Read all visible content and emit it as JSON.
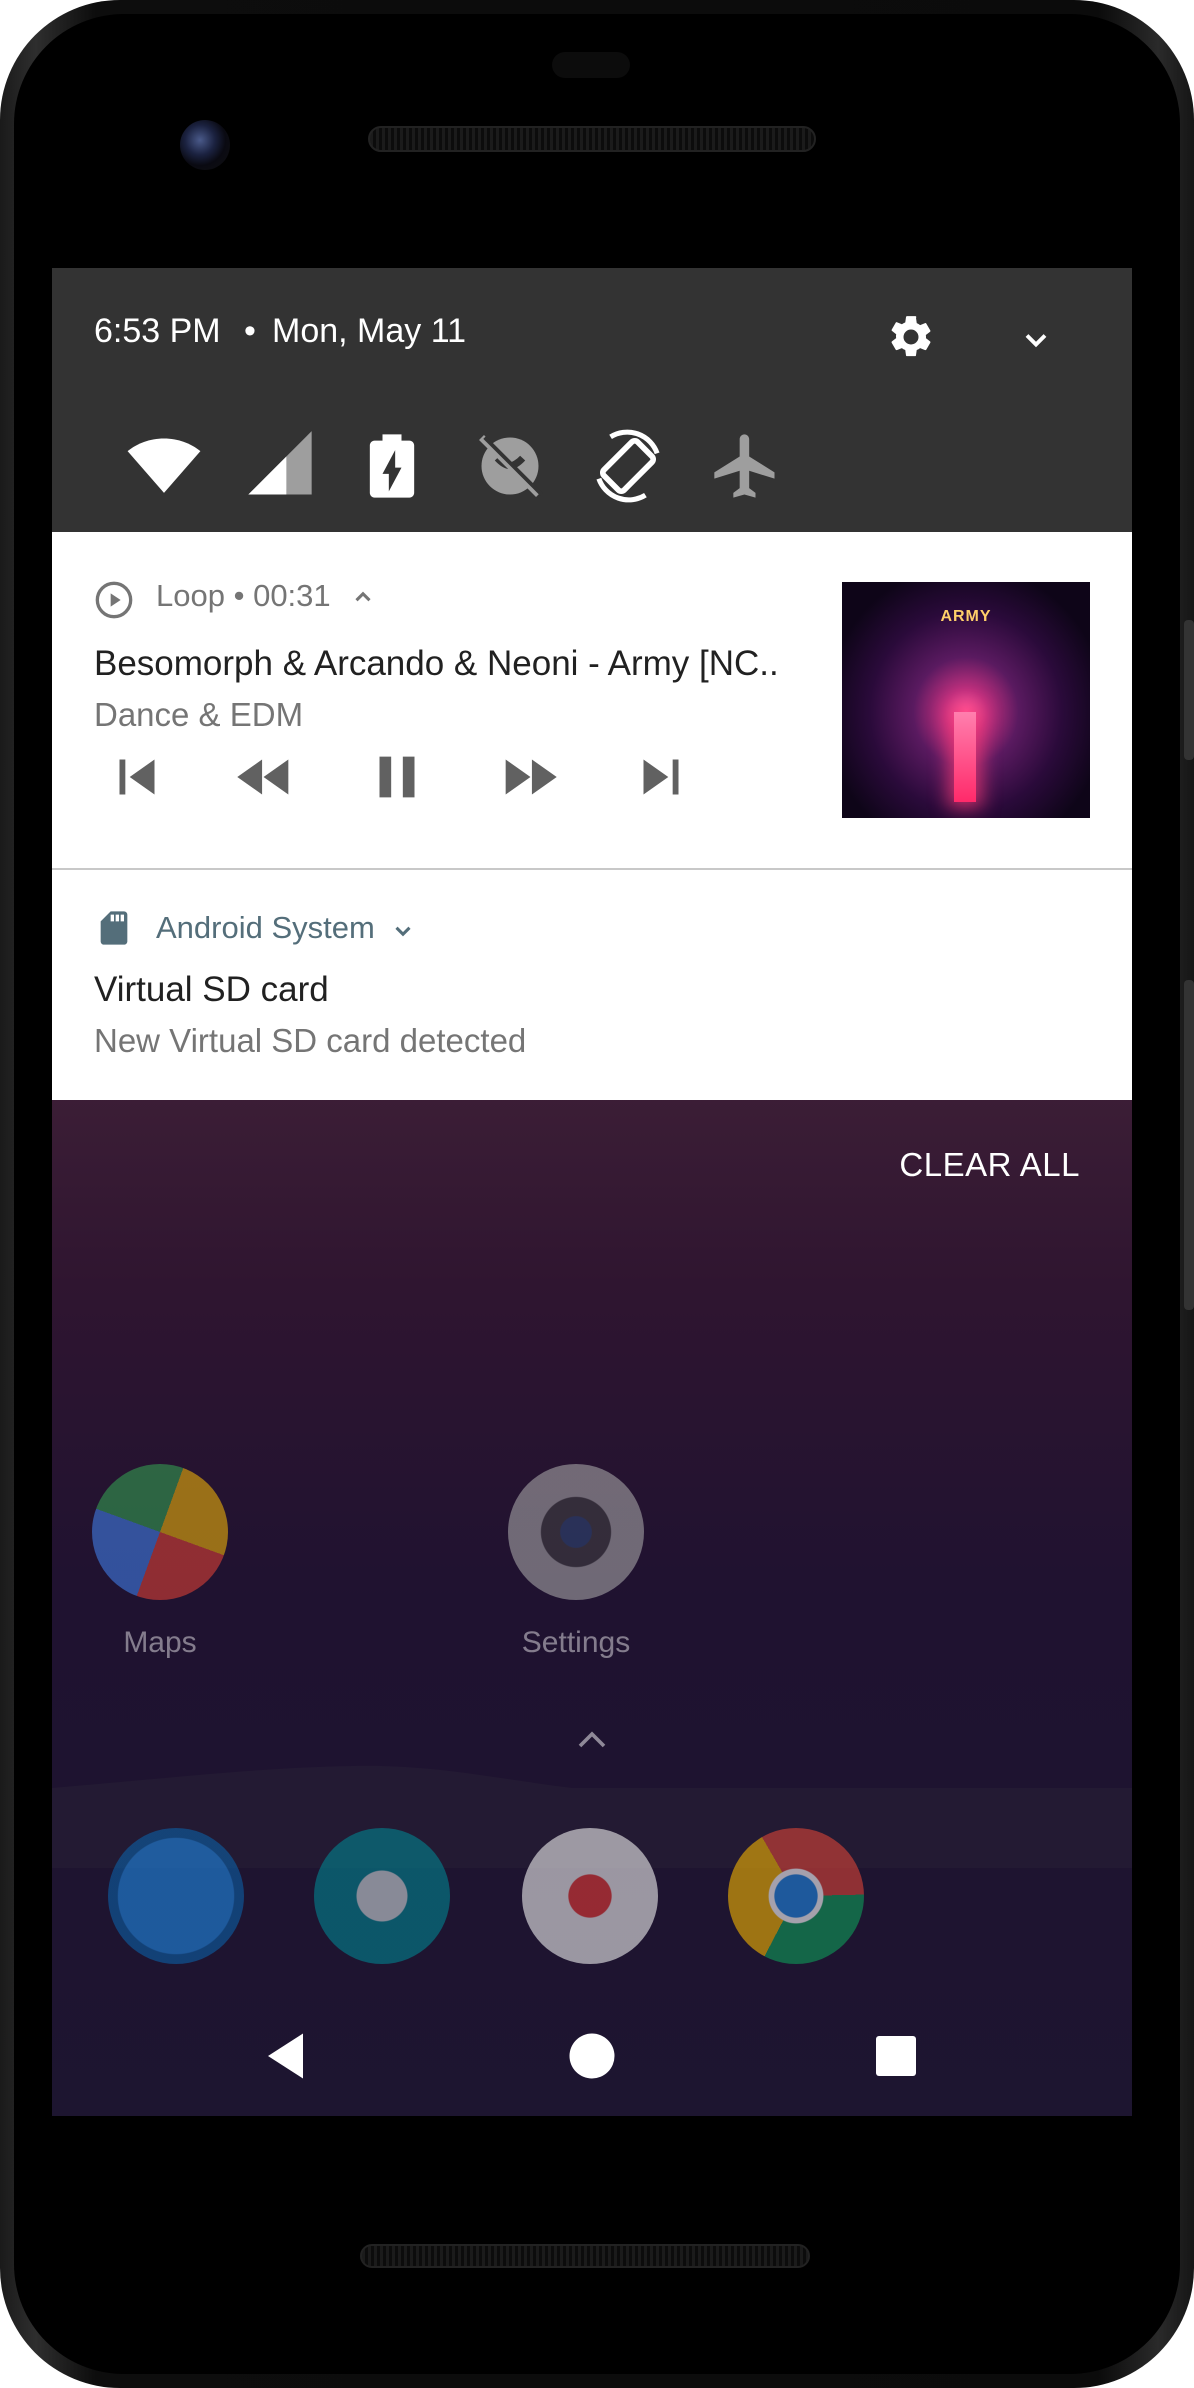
{
  "status": {
    "time": "6:53 PM",
    "separator": "•",
    "date": "Mon, May 11"
  },
  "quick_settings": {
    "header_icons": [
      "settings-gear-icon",
      "expand-chevron-icon"
    ],
    "tiles": [
      "wifi-icon",
      "cellular-signal-icon",
      "battery-charging-icon",
      "data-saver-off-icon",
      "auto-rotate-icon",
      "airplane-mode-icon"
    ]
  },
  "media_notification": {
    "app_name": "Loop",
    "elapsed": "00:31",
    "separator": "•",
    "title": "Besomorph & Arcando & Neoni - Army [NC..",
    "subtitle": "Dance & EDM",
    "controls": [
      "skip-previous-icon",
      "rewind-icon",
      "pause-icon",
      "fast-forward-icon",
      "skip-next-icon"
    ],
    "album_art_text": "ARMY"
  },
  "system_notification": {
    "app_name": "Android System",
    "title": "Virtual SD card",
    "text": "New Virtual SD card detected"
  },
  "shade": {
    "clear_all_label": "CLEAR ALL"
  },
  "home": {
    "apps": [
      {
        "label": "Maps",
        "icon": "maps-icon"
      },
      {
        "label": "Settings",
        "icon": "settings-app-icon"
      }
    ],
    "dock": [
      "phone-icon",
      "messages-icon",
      "gmail-icon",
      "chrome-icon"
    ]
  },
  "navigation": [
    "back-icon",
    "home-icon",
    "recents-icon"
  ],
  "colors": {
    "qs_background": "#333333",
    "notification_background": "#ffffff",
    "accent_system": "#546e7a"
  }
}
